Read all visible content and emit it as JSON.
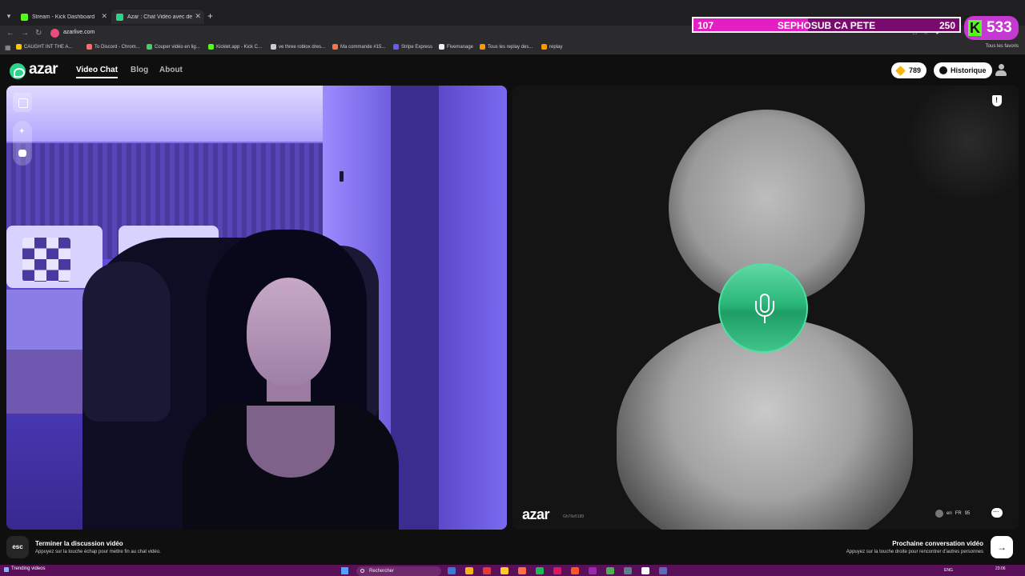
{
  "browser": {
    "tabs": [
      {
        "title": "Stream - Kick Dashboard",
        "favicon_color": "#53fc18"
      },
      {
        "title": "Azar : Chat Vidéo avec de",
        "favicon_color": "#2ed38a"
      }
    ],
    "url": "azarlive.com",
    "bookmarks": [
      {
        "label": "CAUGHT INT THE A...",
        "color": "#f5c518"
      },
      {
        "label": "To Discord - Chrom...",
        "color": "#ff6b6b"
      },
      {
        "label": "Couper vidéo en lig...",
        "color": "#3bd16f"
      },
      {
        "label": "Kicklet.app - Kick C...",
        "color": "#53fc18"
      },
      {
        "label": "ve three roblox dres...",
        "color": "#cccccc"
      },
      {
        "label": "Ma commande #15...",
        "color": "#ff7043"
      },
      {
        "label": "Stripe Express",
        "color": "#635bff"
      },
      {
        "label": "Fivemanage",
        "color": "#eeeeee"
      },
      {
        "label": "Tous les replay des...",
        "color": "#ff9800"
      },
      {
        "label": "replay",
        "color": "#ff9800"
      }
    ],
    "bookmarks_right": "Tous les favoris"
  },
  "overlay": {
    "sub_start": "107",
    "sub_title": "SEPHOSUB CA PETE",
    "sub_goal": "250",
    "sub_progress": 0.43,
    "kick_count": "533"
  },
  "azar": {
    "logo": "azar",
    "nav": [
      {
        "label": "Video Chat",
        "active": true
      },
      {
        "label": "Blog",
        "active": false
      },
      {
        "label": "About",
        "active": false
      }
    ],
    "gems": "789",
    "history_label": "Historique"
  },
  "remote": {
    "watermark": "azar",
    "watermark_id": "Gh70e5189",
    "peer_lang": "en",
    "peer_country": "FR",
    "peer_score": "95"
  },
  "hints": {
    "esc_key": "esc",
    "end_title": "Terminer la discussion vidéo",
    "end_sub": "Appuyez sur la touche échap pour mettre fin au chat vidéo.",
    "next_title": "Prochaine conversation vidéo",
    "next_sub": "Appuyez sur la touche droite pour rencontrer d'autres personnes"
  },
  "taskbar": {
    "trending": "Trending videos",
    "search_placeholder": "Rechercher",
    "lang": "ENG",
    "time": "23:06",
    "apps": [
      "#3a7bd5",
      "#f5b512",
      "#e53935",
      "#ffca28",
      "#ff7043",
      "#1db954",
      "#d81b60",
      "#ff5722",
      "#9c27b0",
      "#4caf50",
      "#607d8b",
      "#ffffff",
      "#5c6bc0"
    ]
  }
}
